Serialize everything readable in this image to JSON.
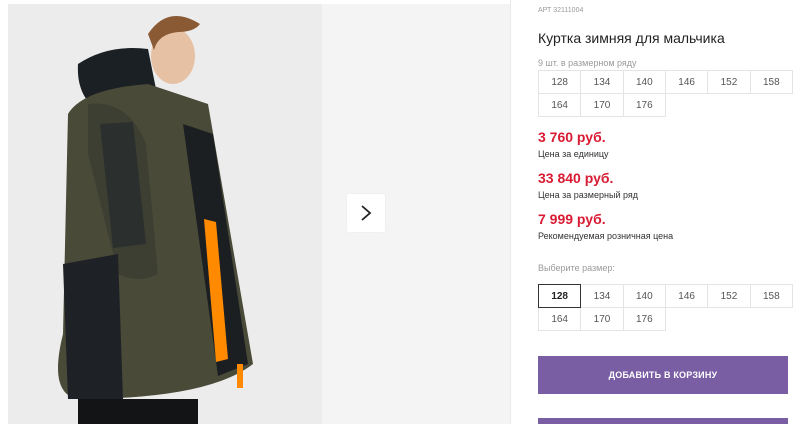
{
  "gallery": {
    "next_icon": "chevron-right-icon"
  },
  "product": {
    "sku": "АРТ 32111004",
    "title": "Куртка зимняя для мальчика",
    "row_note": "9 шт. в размерном ряду",
    "row_sizes": [
      "128",
      "134",
      "140",
      "146",
      "152",
      "158",
      "164",
      "170",
      "176"
    ]
  },
  "prices": {
    "unit_price": "3 760 руб.",
    "unit_label": "Цена за единицу",
    "row_price": "33 840 руб.",
    "row_label": "Цена за размерный ряд",
    "retail_price": "7 999 руб.",
    "retail_label": "Рекомендуемая розничная цена",
    "price_color": "#d81b32"
  },
  "size_select": {
    "label": "Выберите размер:",
    "selected": "128",
    "options": [
      "128",
      "134",
      "140",
      "146",
      "152",
      "158",
      "164",
      "170",
      "176"
    ]
  },
  "actions": {
    "add_to_cart": "ДОБАВИТЬ В КОРЗИНУ",
    "button_color": "#7a5ea4"
  }
}
